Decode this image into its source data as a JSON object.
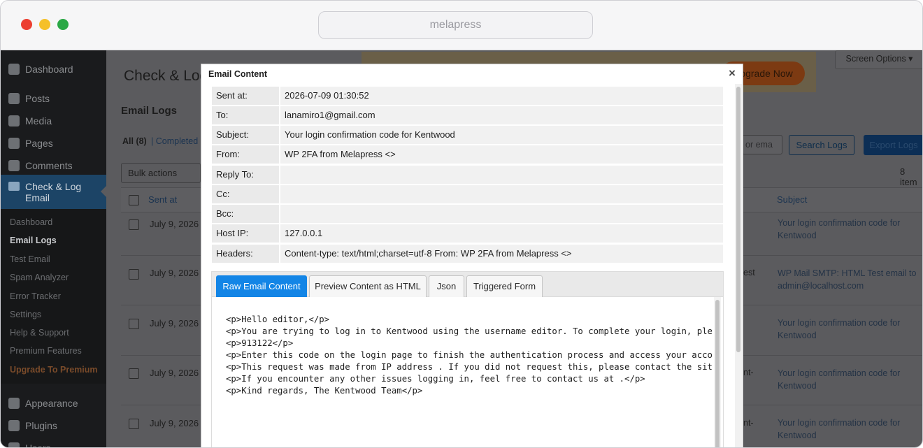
{
  "browser": {
    "url": "melapress"
  },
  "sidebar": {
    "items": [
      {
        "label": "Dashboard",
        "icon": "dashboard-icon"
      },
      {
        "label": "Posts",
        "icon": "pin-icon"
      },
      {
        "label": "Media",
        "icon": "media-icon"
      },
      {
        "label": "Pages",
        "icon": "pages-icon"
      },
      {
        "label": "Comments",
        "icon": "comment-icon"
      }
    ],
    "active": {
      "label": "Check & Log Email",
      "icon": "email-icon"
    },
    "submenu": [
      "Dashboard",
      "Email Logs",
      "Test Email",
      "Spam Analyzer",
      "Error Tracker",
      "Settings",
      "Help & Support",
      "Premium Features",
      "Upgrade To Premium"
    ],
    "lower": [
      {
        "label": "Appearance",
        "icon": "brush-icon"
      },
      {
        "label": "Plugins",
        "icon": "plugin-icon"
      },
      {
        "label": "Users",
        "icon": "users-icon"
      }
    ]
  },
  "page": {
    "title": "Check & Log",
    "upgrade_label": "Upgrade Now",
    "screen_options": "Screen Options ▾",
    "section": "Email Logs",
    "filter_all": "All (8)",
    "filter_completed": "| Completed",
    "search_placeholder": "or ema",
    "search_button": "Search Logs",
    "export_button": "Export Logs",
    "bulk_actions": "Bulk actions",
    "item_count": "8 item",
    "col_sent": "Sent at",
    "col_subject": "Subject",
    "rows": [
      {
        "date": "July 9, 2026",
        "mid": "",
        "subject": "Your login confirmation code for Kentwood"
      },
      {
        "date": "July 9, 2026",
        "mid": "est",
        "subject": "WP Mail SMTP: HTML Test email to admin@localhost.com"
      },
      {
        "date": "July 9, 2026",
        "mid": "",
        "subject": "Your login confirmation code for Kentwood"
      },
      {
        "date": "July 9, 2026",
        "mid": "nt-",
        "subject": "Your login confirmation code for Kentwood"
      },
      {
        "date": "July 9, 2026",
        "mid": "nt-",
        "subject": "Your login confirmation code for Kentwood"
      }
    ]
  },
  "modal": {
    "title": "Email Content",
    "close": "×",
    "fields": [
      {
        "label": "Sent at:",
        "value": "2026-07-09 01:30:52"
      },
      {
        "label": "To:",
        "value": "lanamiro1@gmail.com"
      },
      {
        "label": "Subject:",
        "value": "Your login confirmation code for Kentwood"
      },
      {
        "label": "From:",
        "value": "WP 2FA from Melapress <>"
      },
      {
        "label": "Reply To:",
        "value": ""
      },
      {
        "label": "Cc:",
        "value": ""
      },
      {
        "label": "Bcc:",
        "value": ""
      },
      {
        "label": "Host IP:",
        "value": "127.0.0.1"
      },
      {
        "label": "Headers:",
        "value": "Content-type: text/html;charset=utf-8 From: WP 2FA from Melapress <>"
      }
    ],
    "tabs": [
      "Raw Email Content",
      "Preview Content as HTML",
      "Json",
      "Triggered Form"
    ],
    "code_lines": [
      "<p>Hello editor,</p>",
      "<p>You are trying to log in to Kentwood using the username editor. To complete your login, plea",
      "<p>913122</p>",
      "<p>Enter this code on the login page to finish the authentication process and access your accou",
      "<p>This request was made from IP address . If you did not request this, please contact the site",
      "<p>If you encounter any other issues logging in, feel free to contact us at .</p>",
      "<p>Kind regards, The Kentwood Team</p>"
    ]
  },
  "colors": {
    "accent": "#1385e6",
    "sidebar": "#1a1b1d",
    "upgrade": "#e05d10"
  }
}
